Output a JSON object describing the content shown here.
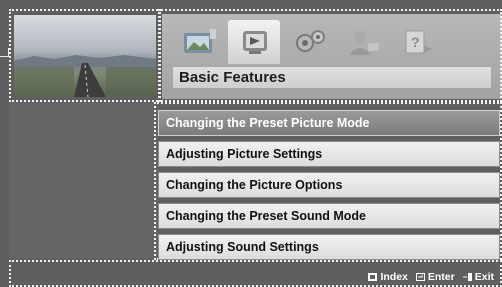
{
  "menu": {
    "icons": [
      "picture-menu-icon",
      "tv-menu-icon",
      "setup-menu-icon",
      "support-menu-icon",
      "help-menu-icon"
    ],
    "active_index": 1,
    "section_title": "Basic Features"
  },
  "list": {
    "items": [
      "Changing the Preset Picture Mode",
      "Adjusting Picture Settings",
      "Changing the Picture Options",
      "Changing the Preset Sound Mode",
      "Adjusting Sound Settings"
    ],
    "selected_index": 0
  },
  "footer": {
    "index": "Index",
    "enter": "Enter",
    "exit": "Exit"
  },
  "colors": {
    "background": "#5f5f5f",
    "selected": "#8a8a8a",
    "item": "#e6e6e6"
  }
}
